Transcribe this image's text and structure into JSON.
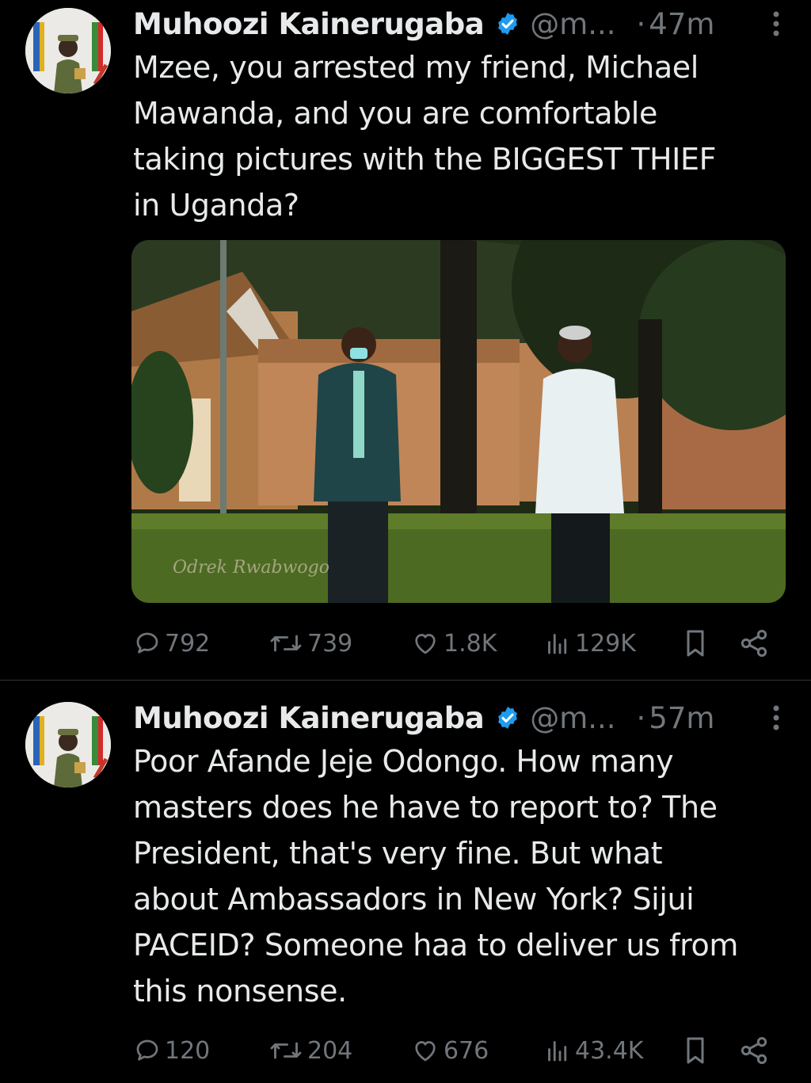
{
  "tweets": [
    {
      "author_name": "Muhoozi Kainerugaba",
      "handle": "@m...",
      "time": "47m",
      "dot": "·",
      "text": "Mzee, you arrested my friend, Michael\nMawanda, and you are comfortable\ntaking pictures with the BIGGEST THIEF\nin Uganda?",
      "image_watermark": "Odrek Rwabwogo",
      "replies": "792",
      "reposts": "739",
      "likes": "1.8K",
      "views": "129K"
    },
    {
      "author_name": "Muhoozi Kainerugaba",
      "handle": "@m...",
      "time": "57m",
      "dot": "·",
      "text": "Poor Afande Jeje Odongo. How many\nmasters does he have to report to? The\nPresident, that's very fine. But what\nabout Ambassadors in New York? Sijui\nPACEID? Someone haa to deliver us from\nthis nonsense.",
      "replies": "120",
      "reposts": "204",
      "likes": "676",
      "views": "43.4K"
    }
  ],
  "icons": {
    "verified": "verified-badge-icon",
    "more": "more-vertical-icon",
    "reply": "reply-icon",
    "repost": "repost-icon",
    "like": "like-icon",
    "views": "views-icon",
    "bookmark": "bookmark-icon",
    "share": "share-icon"
  },
  "colors": {
    "background": "#000000",
    "text": "#e7e9ea",
    "secondary": "#71767b",
    "verified": "#1d9bf0",
    "divider": "#2f3336"
  }
}
